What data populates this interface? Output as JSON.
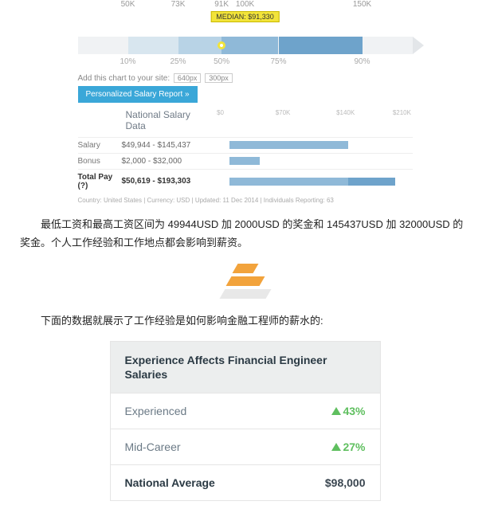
{
  "chart_data": {
    "type": "bar",
    "title": "National Salary Data",
    "median_label": "MEDIAN: $91,330",
    "percentile_ticks": [
      "10%",
      "25%",
      "50%",
      "75%",
      "90%"
    ],
    "value_ticks": [
      "50K",
      "73K",
      "91K",
      "100K",
      "150K"
    ],
    "percentile_pos": [
      15,
      30,
      43,
      60,
      85
    ],
    "value_pos": [
      15,
      30,
      43,
      50,
      85
    ],
    "segments": [
      {
        "left": 15,
        "width": 15,
        "color": "#d8e6ef"
      },
      {
        "left": 30,
        "width": 13,
        "color": "#b8d3e6"
      },
      {
        "left": 43,
        "width": 17,
        "color": "#8fb9d8"
      },
      {
        "left": 60,
        "width": 25,
        "color": "#6ea3cb"
      }
    ],
    "series": [
      {
        "name": "Salary",
        "range": "$49,944 - $145,437",
        "bars": [
          {
            "left": 15,
            "width": 55,
            "color": "#8fb9d8"
          }
        ]
      },
      {
        "name": "Bonus",
        "range": "$2,000 - $32,000",
        "bars": [
          {
            "left": 15,
            "width": 14,
            "color": "#8fb9d8"
          }
        ]
      },
      {
        "name": "Total Pay (?)",
        "range": "$50,619 - $193,303",
        "bars": [
          {
            "left": 15,
            "width": 55,
            "color": "#8fb9d8"
          },
          {
            "left": 70,
            "width": 22,
            "color": "#6ea3cb"
          }
        ]
      }
    ],
    "mini_ticks": [
      {
        "pos": 8,
        "label": "$0"
      },
      {
        "pos": 38,
        "label": "$70K"
      },
      {
        "pos": 68,
        "label": "$140K"
      },
      {
        "pos": 95,
        "label": "$210K"
      }
    ],
    "embed": {
      "text": "Add this chart to your site:",
      "opts": [
        "640px",
        "300px"
      ]
    },
    "button": "Personalized Salary Report »",
    "footer": "Country: United States | Currency: USD | Updated: 11 Dec 2014 | Individuals Reporting: 63"
  },
  "para1": "最低工资和最高工资区间为 49944USD 加 2000USD 的奖金和 145437USD 加 32000USD 的奖金。个人工作经验和工作地点都会影响到薪资。",
  "para2": "下面的数据就展示了工作经验是如何影响金融工程师的薪水的:",
  "card": {
    "title": "Experience Affects Financial Engineer Salaries",
    "rows": [
      {
        "label": "Experienced",
        "value": "43%",
        "up": true
      },
      {
        "label": "Mid-Career",
        "value": "27%",
        "up": true
      }
    ],
    "avg": {
      "label": "National Average",
      "value": "$98,000"
    }
  }
}
